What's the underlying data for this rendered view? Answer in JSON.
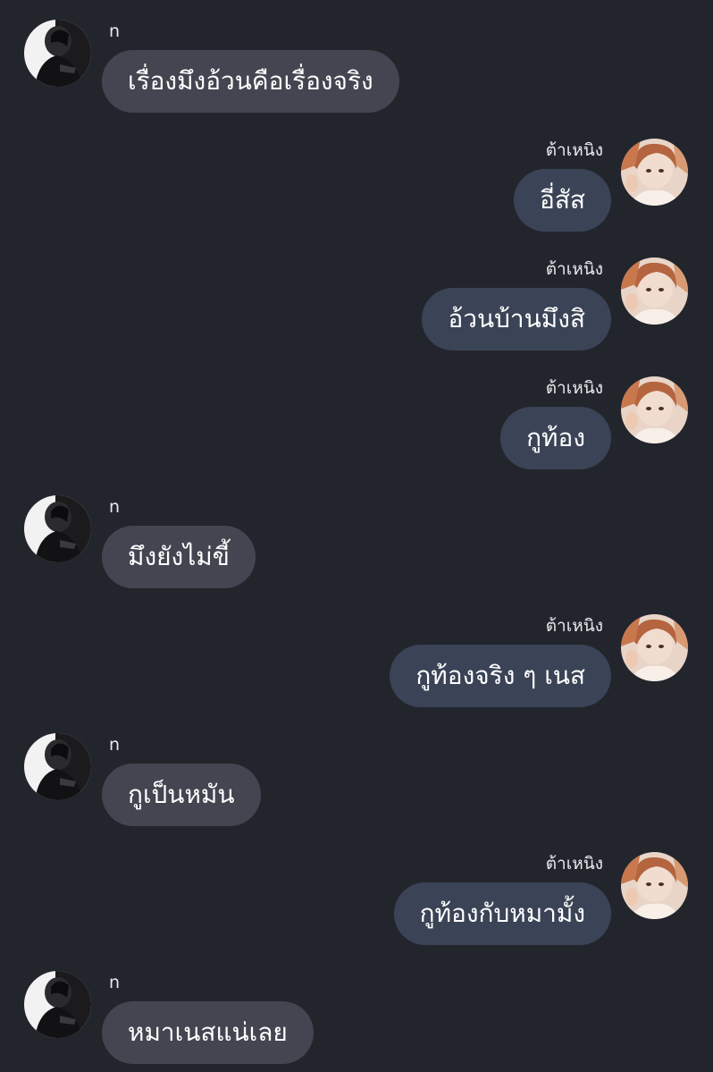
{
  "users": {
    "left": {
      "name": "n",
      "avatar": "monochrome-portrait"
    },
    "right": {
      "name": "ต้าเหนิง",
      "avatar": "warm-toned-portrait"
    }
  },
  "messages": [
    {
      "side": "left",
      "sender": "n",
      "text": "เรื่องมึงอ้วนคือเรื่องจริง"
    },
    {
      "side": "right",
      "sender": "ต้าเหนิง",
      "text": "อี่สัส"
    },
    {
      "side": "right",
      "sender": "ต้าเหนิง",
      "text": "อ้วนบ้านมึงสิ"
    },
    {
      "side": "right",
      "sender": "ต้าเหนิง",
      "text": "กูท้อง"
    },
    {
      "side": "left",
      "sender": "n",
      "text": "มึงยังไม่ขี้"
    },
    {
      "side": "right",
      "sender": "ต้าเหนิง",
      "text": "กูท้องจริง ๆ เนส"
    },
    {
      "side": "left",
      "sender": "n",
      "text": "กูเป็นหมัน"
    },
    {
      "side": "right",
      "sender": "ต้าเหนิง",
      "text": "กูท้องกับหมามั้ง"
    },
    {
      "side": "left",
      "sender": "n",
      "text": "หมาเนสแน่เลย"
    }
  ],
  "colors": {
    "background": "#23252d",
    "left_bubble": "#434651",
    "right_bubble": "#3a4456",
    "text": "#ffffff"
  }
}
